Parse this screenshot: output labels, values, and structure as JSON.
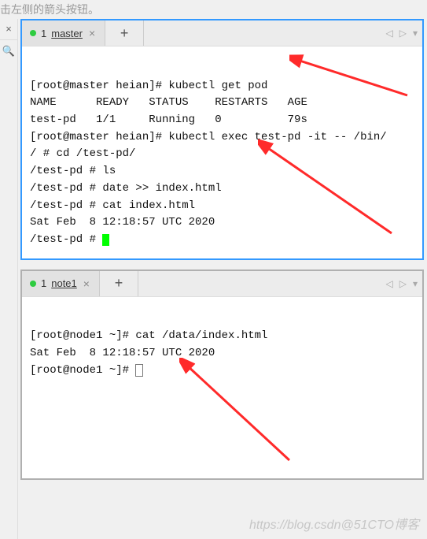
{
  "hint_text": "击左侧的箭头按钮。",
  "sidebar": {
    "close_glyph": "×",
    "search_glyph": "🔍"
  },
  "tab_nav": {
    "left": "◁",
    "right": "▷",
    "menu": "▾"
  },
  "pane1": {
    "tab": {
      "index": "1",
      "label": "master",
      "close": "×",
      "add": "+"
    },
    "lines": [
      "",
      "[root@master heian]# kubectl get pod",
      "NAME      READY   STATUS    RESTARTS   AGE",
      "test-pd   1/1     Running   0          79s",
      "[root@master heian]# kubectl exec test-pd -it -- /bin/",
      "/ # cd /test-pd/",
      "/test-pd # ls",
      "/test-pd # date >> index.html",
      "/test-pd # cat index.html",
      "Sat Feb  8 12:18:57 UTC 2020",
      "/test-pd # "
    ]
  },
  "pane2": {
    "tab": {
      "index": "1",
      "label": "note1",
      "close": "×",
      "add": "+"
    },
    "lines": [
      "",
      "[root@node1 ~]# cat /data/index.html",
      "Sat Feb  8 12:18:57 UTC 2020",
      "[root@node1 ~]# "
    ]
  },
  "watermark": "https://blog.csdn@51CTO博客"
}
